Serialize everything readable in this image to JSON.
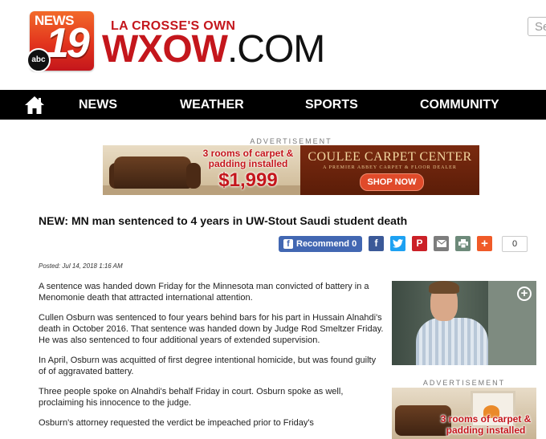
{
  "brand": {
    "logo_news": "NEWS",
    "logo_number": "19",
    "logo_network": "abc",
    "tagline": "LA CROSSE'S OWN",
    "site_name": "WXOW",
    "site_tld": ".COM"
  },
  "search": {
    "placeholder": "Se"
  },
  "nav": {
    "home_icon": "home-icon",
    "items": [
      {
        "label": "NEWS"
      },
      {
        "label": "WEATHER"
      },
      {
        "label": "SPORTS"
      },
      {
        "label": "COMMUNITY"
      }
    ]
  },
  "ads": {
    "label": "ADVERTISEMENT",
    "banner": {
      "promo": "3 rooms of carpet & padding installed",
      "price": "$1,999",
      "brand": "COULEE CARPET CENTER",
      "brand_sub": "A PREMIER ABBEY CARPET & FLOOR DEALER",
      "cta": "SHOP NOW"
    },
    "sidebar": {
      "label": "ADVERTISEMENT",
      "promo": "3 rooms of carpet & padding installed"
    }
  },
  "article": {
    "headline": "NEW: MN man sentenced to 4 years in UW-Stout Saudi student death",
    "posted_label": "Posted:",
    "posted_date": "Jul 14, 2018 1:16 AM",
    "paragraphs": [
      "A sentence was handed down Friday for the Minnesota man convicted of battery in a Menomonie death that attracted international attention.",
      "Cullen Osburn was sentenced to four years behind bars for his part in Hussain Alnahdi's death in October 2016. That sentence was handed down by Judge Rod Smeltzer Friday. He was also sentenced to four additional years of extended supervision.",
      "In April, Osburn was acquitted of first degree intentional homicide, but was found guilty of of aggravated battery.",
      "Three people spoke on Alnahdi's behalf Friday in court. Osburn spoke as well, proclaiming his innocence to the judge.",
      "Osburn's attorney requested the verdict be impeached prior to Friday's"
    ]
  },
  "share": {
    "recommend_label": "Recommend 0",
    "count": "0",
    "icons": [
      "facebook-icon",
      "twitter-icon",
      "pinterest-icon",
      "email-icon",
      "print-icon",
      "more-icon"
    ],
    "colors": {
      "facebook": "#3b5998",
      "twitter": "#1da1f2",
      "pinterest": "#cb2027",
      "email": "#7d7d7d",
      "print": "#6d8a7a",
      "more": "#f05a28"
    }
  },
  "colors": {
    "brand_red": "#c4161c",
    "nav_bg": "#000000",
    "recommend_blue": "#4267b2"
  }
}
